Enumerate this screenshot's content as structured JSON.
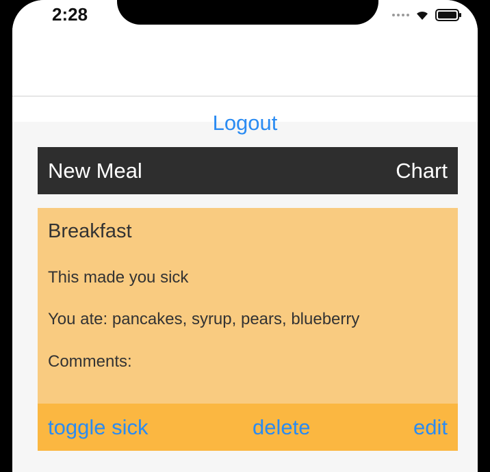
{
  "status": {
    "time": "2:28"
  },
  "header": {
    "logout_label": "Logout"
  },
  "toolbar": {
    "new_meal_label": "New Meal",
    "chart_label": "Chart"
  },
  "meal_card": {
    "title": "Breakfast",
    "sick_text": "This made you sick",
    "ate_text": "You ate: pancakes, syrup, pears, blueberry",
    "comments_text": "Comments:",
    "actions": {
      "toggle_sick": "toggle sick",
      "delete": "delete",
      "edit": "edit"
    }
  },
  "colors": {
    "accent": "#2a8bf2",
    "toolbar_bg": "#2e2e2e",
    "card_bg": "#f9cb80",
    "card_actions_bg": "#fbb741"
  },
  "icons": [
    "signal-icon",
    "wifi-icon",
    "battery-icon"
  ]
}
